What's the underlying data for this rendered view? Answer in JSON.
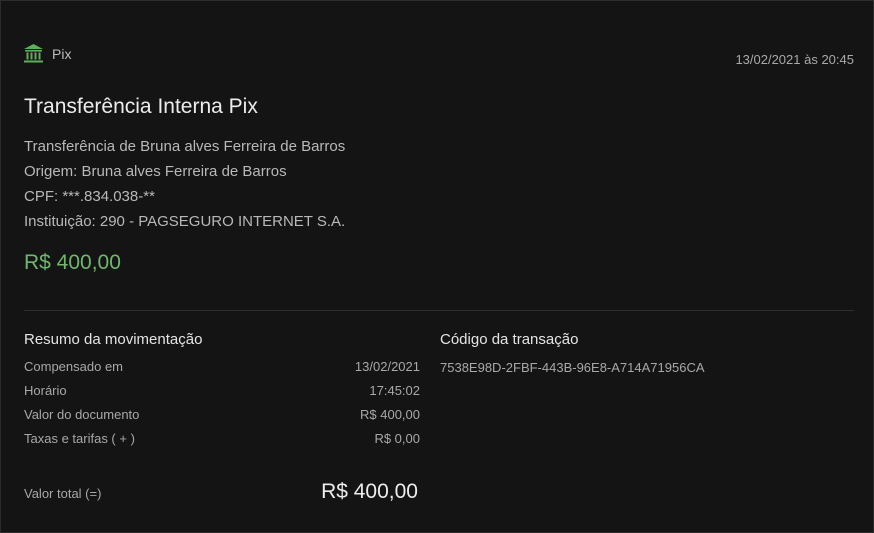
{
  "header": {
    "category_icon": "bank-icon",
    "category_label": "Pix",
    "datetime": "13/02/2021 às 20:45"
  },
  "transaction": {
    "title": "Transferência Interna Pix",
    "details": [
      "Transferência de Bruna alves Ferreira de Barros",
      "Origem: Bruna alves Ferreira de Barros",
      "CPF: ***.834.038-**",
      "Instituição: 290 - PAGSEGURO INTERNET S.A."
    ],
    "amount": "R$ 400,00"
  },
  "summary": {
    "title": "Resumo da movimentação",
    "rows": [
      {
        "label": "Compensado em",
        "value": "13/02/2021"
      },
      {
        "label": "Horário",
        "value": "17:45:02"
      },
      {
        "label": "Valor do documento",
        "value": "R$ 400,00"
      },
      {
        "label": "Taxas e tarifas ( + )",
        "value": "R$ 0,00"
      }
    ],
    "total_label": "Valor total (=)",
    "total_value": "R$ 400,00"
  },
  "code": {
    "title": "Código da transação",
    "value": "7538E98D-2FBF-443B-96E8-A714A71956CA"
  },
  "colors": {
    "background": "#141414",
    "accent_green": "#6fb76d",
    "icon_green": "#5fae5c"
  }
}
